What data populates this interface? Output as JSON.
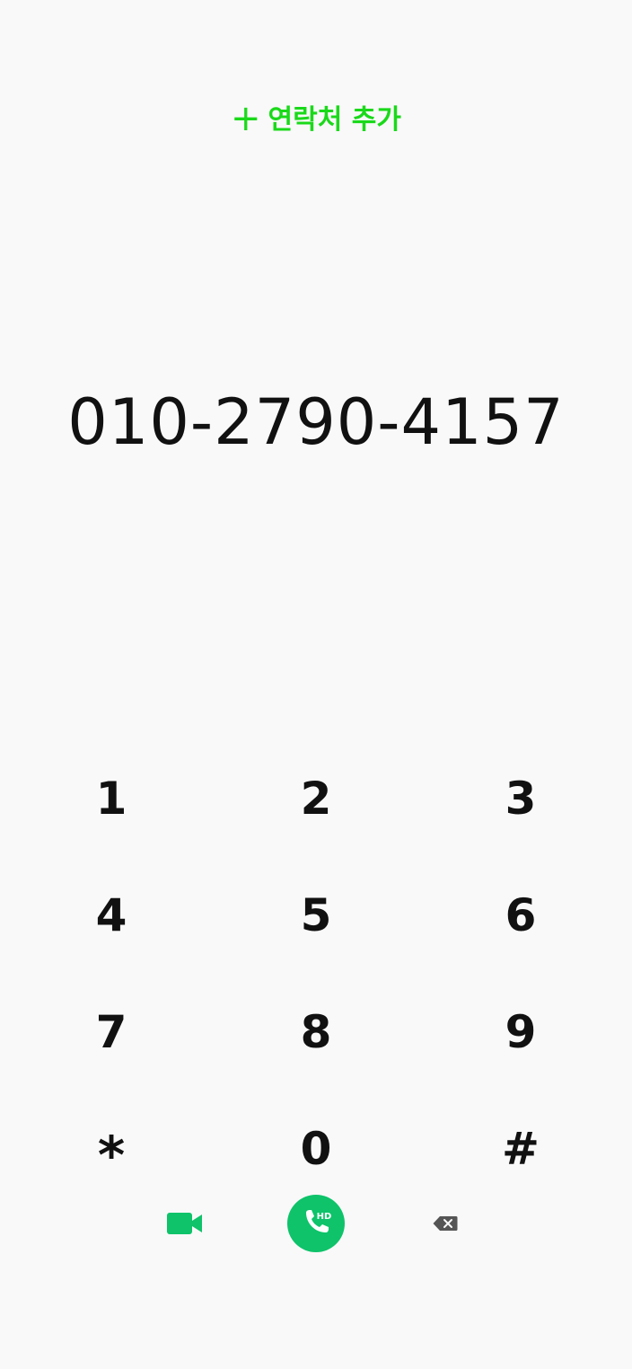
{
  "add_contact": {
    "label": "연락처 추가",
    "icon": "plus-icon",
    "color": "#1ad91a"
  },
  "dialed_number": "010-2790-4157",
  "keypad": {
    "keys": [
      "1",
      "2",
      "3",
      "4",
      "5",
      "6",
      "7",
      "8",
      "9",
      "*",
      "0",
      "#"
    ]
  },
  "actions": {
    "video_call_icon": "video-camera-icon",
    "voice_call_icon": "phone-hd-icon",
    "voice_call_badge": "HD",
    "backspace_icon": "backspace-icon",
    "accent_color": "#0ec36a"
  }
}
